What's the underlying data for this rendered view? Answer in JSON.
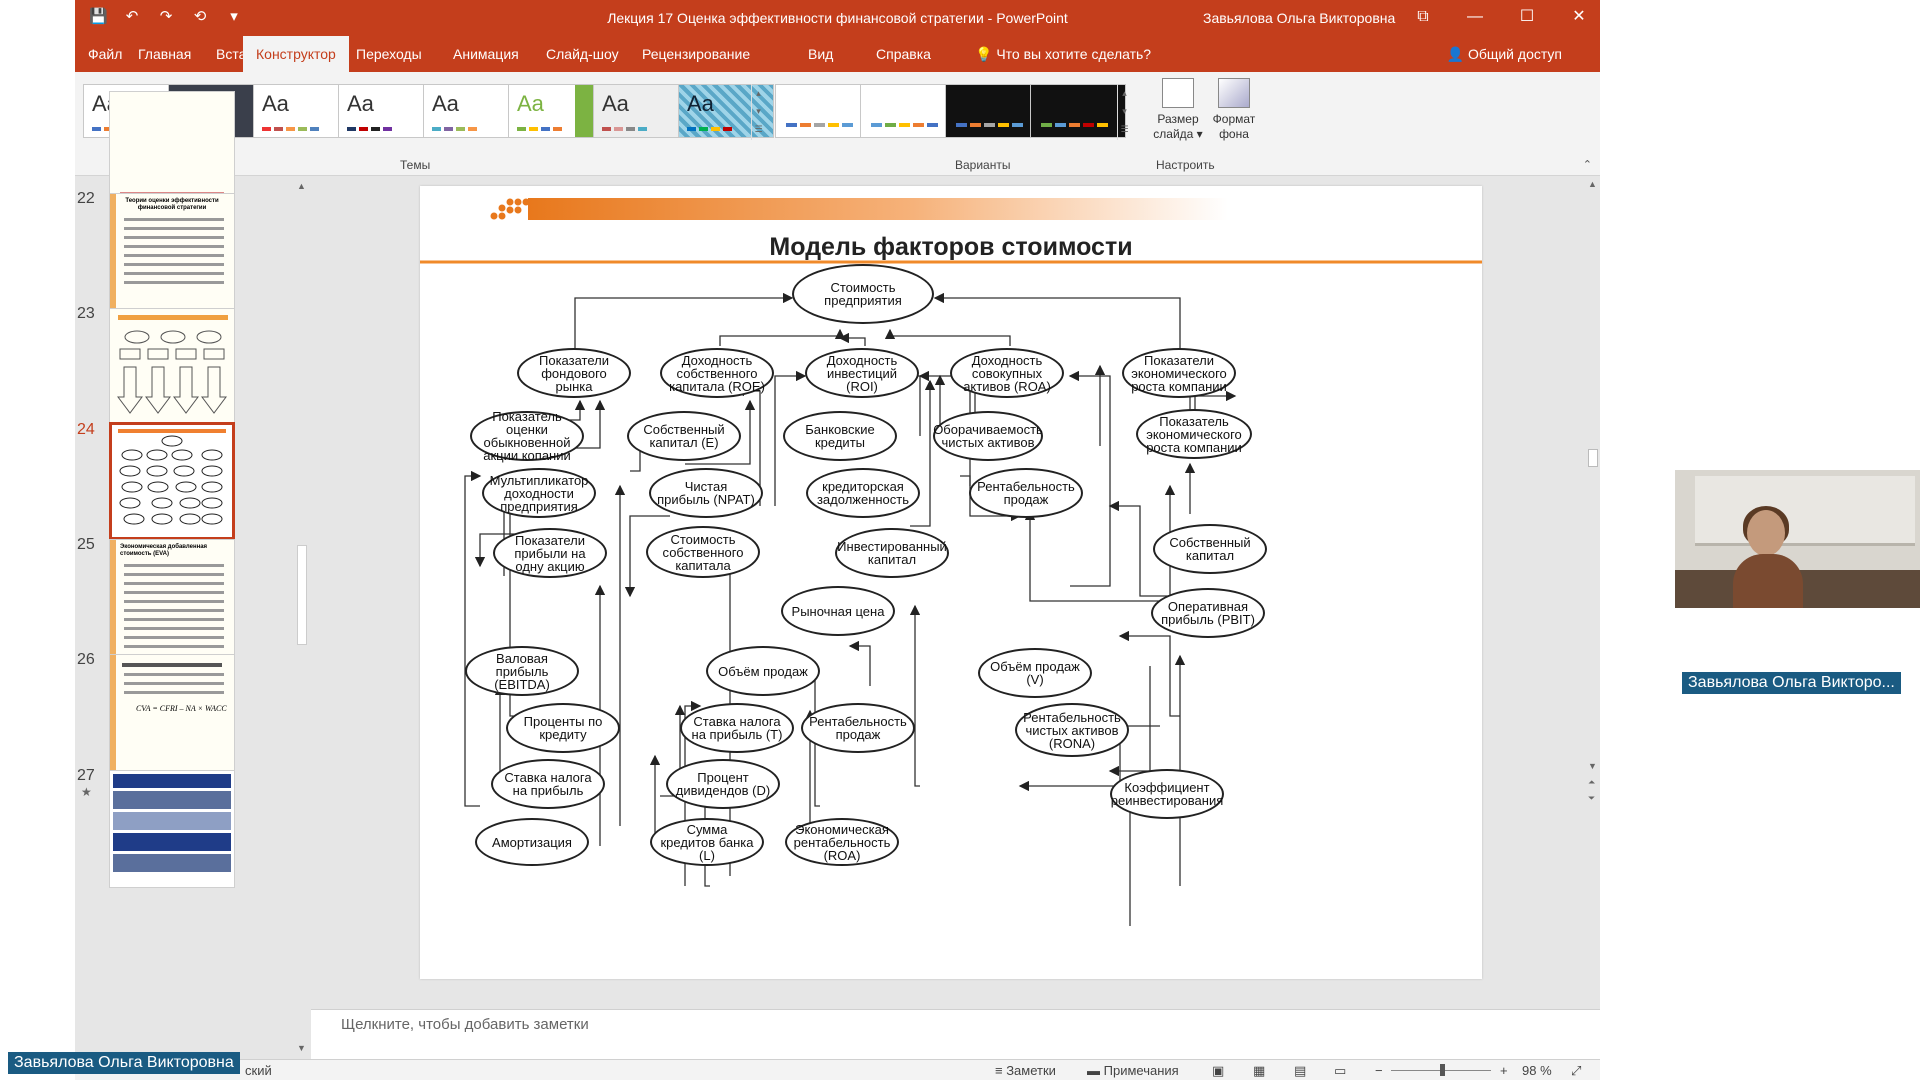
{
  "window": {
    "title": "Лекция 17 Оценка эффективности финансовой стратегии  -  PowerPoint",
    "user": "Завьялова Ольга Викторовна",
    "controls": {
      "restore_ribbon": "⧉",
      "minimize": "—",
      "maximize": "☐",
      "close": "✕"
    }
  },
  "qat": {
    "save": "💾",
    "undo": "↶",
    "redo": "↷",
    "present": "⟲",
    "customize": "▾"
  },
  "tabs": [
    "Файл",
    "Главная",
    "Вставка",
    "Конструктор",
    "Переходы",
    "Анимация",
    "Слайд-шоу",
    "Рецензирование",
    "Вид",
    "Справка"
  ],
  "active_tab": "Конструктор",
  "tell_me": "Что вы хотите сделать?",
  "share": "Общий доступ",
  "ribbon": {
    "themes_label": "Темы",
    "variants_label": "Варианты",
    "customize_label": "Настроить",
    "theme_sample": "Aa",
    "slide_size": "Размер слайда",
    "format_bg": "Формат фона",
    "colors": {
      "accent": "#c43e1c",
      "orange": "#f0801c"
    }
  },
  "thumbnails": {
    "numbers": [
      "22",
      "23",
      "24",
      "25",
      "26",
      "27"
    ],
    "star": "★",
    "slide22_title": "Теории оценки эффективности финансовой стратегии",
    "slide25_title": "Экономическая добавленная стоимость (EVA)",
    "slide26_formula": "CVA = CFRI – NA × WACC"
  },
  "slide": {
    "title": "Модель факторов стоимости",
    "nodes": {
      "n_value": "Стоимость предприятия",
      "n_market": "Показатели фондового рынка",
      "n_roe": "Доходность собственного капитала (ROE)",
      "n_roi": "Доходность инвестиций (ROI)",
      "n_roa": "Доходность совокупных активов (ROA)",
      "n_growth1": "Показатели экономического роста компании",
      "n_share": "Показатель оценки обыкновенной акции копании",
      "n_equity_e": "Собственный капитал (E)",
      "n_bank": "Банковские кредиты",
      "n_turnover": "Оборачиваемость чистых активов",
      "n_growth2": "Показатель экономического роста компании",
      "n_mult": "Мультипликатор доходности предприятия",
      "n_npat": "Чистая прибыль (NPAT)",
      "n_payable": "кредиторская задолженность",
      "n_margin1": "Рентабельность продаж",
      "n_eps": "Показатели прибыли на одну акцию",
      "n_cost_eq": "Стоимость собственного капитала",
      "n_invested": "Инвестированный капитал",
      "n_equity2": "Собственный капитал",
      "n_price": "Рыночная цена",
      "n_pbit": "Оперативная прибыль (PBIT)",
      "n_ebitda": "Валовая прибыль (EBITDA)",
      "n_sales": "Объём продаж",
      "n_sales_v": "Объём продаж (V)",
      "n_interest": "Проценты по кредиту",
      "n_tax_t": "Ставка налога на прибыль (T)",
      "n_margin2": "Рентабельность продаж",
      "n_rona": "Рентабельность чистых активов (RONA)",
      "n_tax": "Ставка налога на прибыль",
      "n_div": "Процент дивидендов (D)",
      "n_reinvest": "Коэффициент реинвестирования",
      "n_amort": "Амортизация",
      "n_loans": "Сумма кредитов банка (L)",
      "n_econ": "Экономическая рентабельность (ROA)"
    }
  },
  "notes_placeholder": "Щелкните, чтобы добавить заметки",
  "status": {
    "lang_fragment": "ский",
    "notes": "Заметки",
    "comments": "Примечания",
    "zoom": "98 %",
    "zoom_minus": "−",
    "zoom_plus": "+"
  },
  "video": {
    "participant": "Завьялова Ольга Викторо...",
    "self_name": "Завьялова Ольга Викторовна"
  }
}
